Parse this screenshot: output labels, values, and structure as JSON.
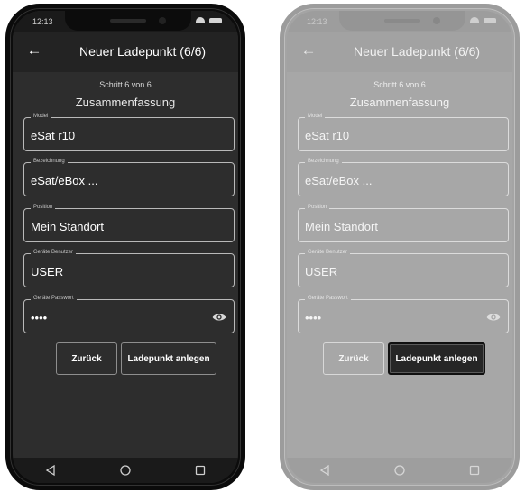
{
  "status": {
    "time": "12:13"
  },
  "appbar": {
    "title": "Neuer Ladepunkt (6/6)",
    "back_icon": "arrow-left-icon"
  },
  "step": "Schritt 6 von 6",
  "section_title": "Zusammenfassung",
  "fields": [
    {
      "label": "Model",
      "value": "eSat r10"
    },
    {
      "label": "Bezeichnung",
      "value": "eSat/eBox ..."
    },
    {
      "label": "Position",
      "value": "Mein Standort"
    },
    {
      "label": "Geräte Benutzer",
      "value": "USER"
    },
    {
      "label": "Geräte Passwort",
      "value": "••••",
      "icon": "eye-icon"
    }
  ],
  "buttons": {
    "back": "Zurück",
    "create": "Ladepunkt anlegen"
  },
  "nav": {
    "back": "triangle-back-icon",
    "home": "circle-home-icon",
    "recent": "square-recent-icon"
  },
  "colors": {
    "dark_bg": "#2d2d2d",
    "light_bg": "#a7a7a7",
    "highlight_button": "#262626"
  }
}
